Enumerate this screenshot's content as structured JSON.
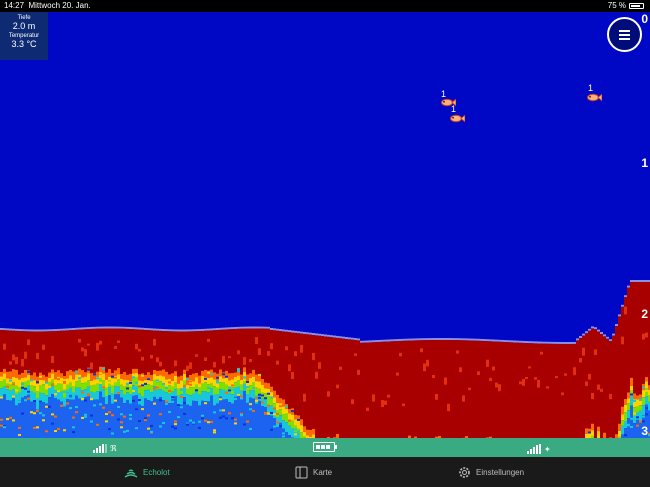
{
  "statusbar": {
    "time": "14:27",
    "date": "Mittwoch 20. Jan.",
    "battery_pct": "75 %",
    "battery_level": 0.75
  },
  "info": {
    "depth_label": "Tiefe",
    "depth_value": "2.0 m",
    "temp_label": "Temperatur",
    "temp_value": "3.3 °C"
  },
  "depth_scale": [
    "0",
    "1",
    "2",
    "3"
  ],
  "fish": [
    {
      "label": "1"
    },
    {
      "label": "1"
    },
    {
      "label": "1"
    }
  ],
  "status": {
    "signal_left_icon": "signal-bluetooth-icon",
    "battery_icon": "battery-icon",
    "signal_right_icon": "signal-gps-icon"
  },
  "tabs": [
    {
      "label": "Echolot",
      "icon": "sonar-icon",
      "active": true
    },
    {
      "label": "Karte",
      "icon": "map-icon",
      "active": false
    },
    {
      "label": "Einstellungen",
      "icon": "gear-icon",
      "active": false
    }
  ],
  "colors": {
    "water": "#0008c6",
    "bottom_red": "#a80000",
    "accent": "#3aaa83",
    "tab_active": "#3fc08f"
  }
}
